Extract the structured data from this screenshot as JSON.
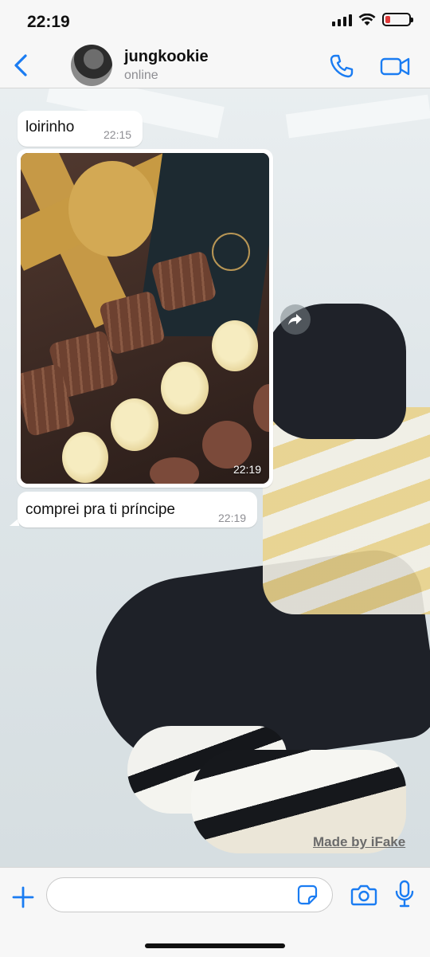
{
  "status_bar": {
    "time": "22:19"
  },
  "header": {
    "contact_name": "jungkookie",
    "contact_status": "online"
  },
  "messages": [
    {
      "type": "text",
      "text": "loirinho",
      "time": "22:15",
      "direction": "incoming"
    },
    {
      "type": "image",
      "image_description_icon": "chocolate-box-photo",
      "time": "22:19",
      "direction": "incoming"
    },
    {
      "type": "text",
      "text": "comprei pra ti príncipe",
      "time": "22:19",
      "direction": "incoming"
    }
  ],
  "watermark": "Made by iFake",
  "input": {
    "placeholder": "",
    "value": ""
  },
  "colors": {
    "accent": "#1a7cf2",
    "battery": "#e03a3a",
    "bubble": "#ffffff"
  }
}
